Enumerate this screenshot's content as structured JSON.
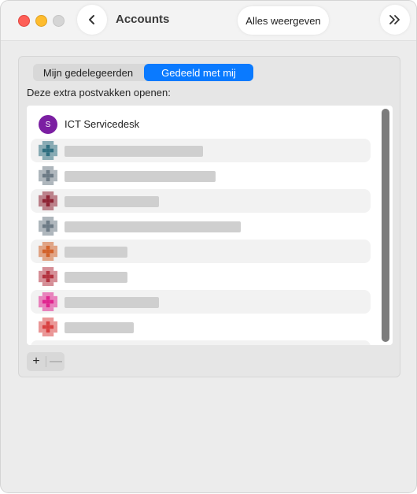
{
  "window": {
    "title": "Accounts",
    "show_all_label": "Alles weergeven",
    "back_icon": "chevron-left-icon",
    "more_icon": "double-chevron-right-icon"
  },
  "segmented": {
    "tabs": [
      {
        "label": "Mijn gedelegeerden",
        "selected": false
      },
      {
        "label": "Gedeeld met mij",
        "selected": true
      }
    ]
  },
  "mailboxes": {
    "prompt": "Deze extra postvakken openen:",
    "first": {
      "avatar_letter": "S",
      "name": "ICT Servicedesk",
      "avatar_color": "#7b1fa2"
    },
    "redacted_rows": [
      {
        "color": "#2f6f80"
      },
      {
        "color": "#6c7a85"
      },
      {
        "color": "#8e2233"
      },
      {
        "color": "#6c7a85"
      },
      {
        "color": "#d2622a"
      },
      {
        "color": "#b3323f"
      },
      {
        "color": "#e0258f"
      },
      {
        "color": "#d84040"
      }
    ]
  },
  "controls": {
    "add_label": "+",
    "remove_label": "—"
  },
  "colors": {
    "accent": "#0a7aff"
  }
}
